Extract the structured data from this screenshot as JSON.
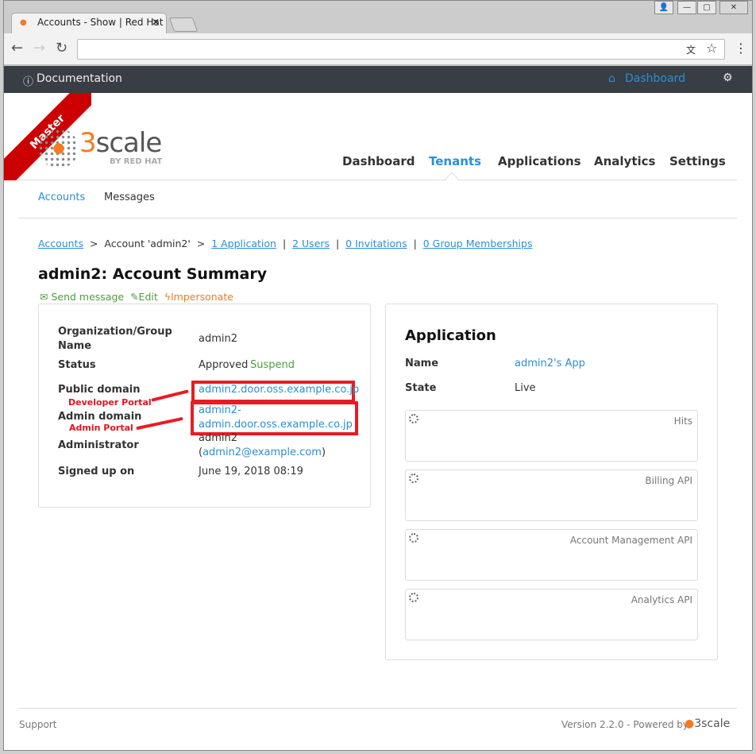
{
  "browser": {
    "tab_title": "Accounts - Show | Red Hat",
    "address": ""
  },
  "topbar": {
    "documentation": "Documentation",
    "dashboard": "Dashboard"
  },
  "logo": {
    "ribbon": "Master",
    "brand": "3scale",
    "sub": "BY RED HAT"
  },
  "main_nav": [
    "Dashboard",
    "Tenants",
    "Applications",
    "Analytics",
    "Settings"
  ],
  "sub_nav": [
    "Accounts",
    "Messages"
  ],
  "breadcrumb": {
    "accounts": "Accounts",
    "sep": ">",
    "current": "Account 'admin2'",
    "applications": "1 Application",
    "users": "2 Users",
    "invitations": "0 Invitations",
    "groups": "0 Group Memberships",
    "bar": "|"
  },
  "title": "admin2: Account Summary",
  "actions": {
    "send": "Send message",
    "edit": "Edit",
    "impersonate": "Impersonate"
  },
  "summary": {
    "org_label": "Organization/Group Name",
    "org": "admin2",
    "status_label": "Status",
    "status": "Approved",
    "suspend": "Suspend",
    "public_label": "Public domain",
    "public": "admin2.door.oss.example.co.jp",
    "admin_label": "Admin domain",
    "admin_1": "admin2-",
    "admin_2": "admin.door.oss.example.co.jp",
    "administrator_label": "Administrator",
    "administrator": "admin2",
    "admin_email": "admin2@example.com",
    "signed_label": "Signed up on",
    "signed": "June 19, 2018 08:19",
    "annotation_dev": "Developer Portal",
    "annotation_admin": "Admin Portal"
  },
  "application": {
    "title": "Application",
    "name_label": "Name",
    "name": "admin2's App",
    "state_label": "State",
    "state": "Live",
    "charts": [
      "Hits",
      "Billing API",
      "Account Management API",
      "Analytics API"
    ]
  },
  "footer": {
    "support": "Support",
    "version": "Version 2.2.0 - Powered by",
    "brand": "3scale"
  }
}
